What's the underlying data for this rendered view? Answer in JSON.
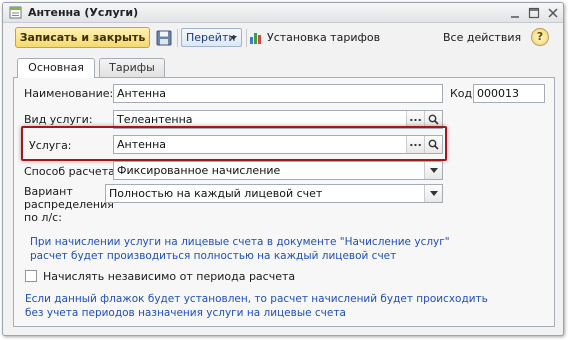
{
  "window": {
    "title": "Антенна (Услуги)"
  },
  "toolbar": {
    "save_close": "Записать и закрыть",
    "goto": "Перейти",
    "tariffs": "Установка тарифов",
    "all_actions": "Все действия",
    "help": "?"
  },
  "tabs": [
    "Основная",
    "Тарифы"
  ],
  "form": {
    "name_label": "Наименование:",
    "name_value": "Антенна",
    "code_label": "Код:",
    "code_value": "000013",
    "service_type_label": "Вид услуги:",
    "service_type_value": "Телеантенна",
    "service_label": "Услуга:",
    "service_value": "Антенна",
    "calc_method_label": "Способ расчета:",
    "calc_method_value": "Фиксированное начисление",
    "distribution_label_1": "Вариант",
    "distribution_label_2": "распределения",
    "distribution_label_3": "по л/с:",
    "distribution_value": "Полностью на каждый лицевой счет",
    "info_1_line_1": "При начислении услуги на лицевые счета в документе \"Начисление услуг\"",
    "info_1_line_2": "расчет будет производиться полностью на каждый лицевой счет",
    "checkbox_label": "Начислять независимо от периода расчета",
    "checkbox_checked": false,
    "info_2_line_1": "Если данный флажок будет установлен, то расчет начислений будет происходить",
    "info_2_line_2": "без учета периодов назначения услуги на лицевые счета",
    "select_button": "...",
    "open_button_icon": "magnifier-icon",
    "dropdown_icon": "triangle-down-icon"
  },
  "colors": {
    "accent_save": "#f5d96b",
    "info_text": "#1f4fb5",
    "highlight_border": "#9b1b1f"
  }
}
